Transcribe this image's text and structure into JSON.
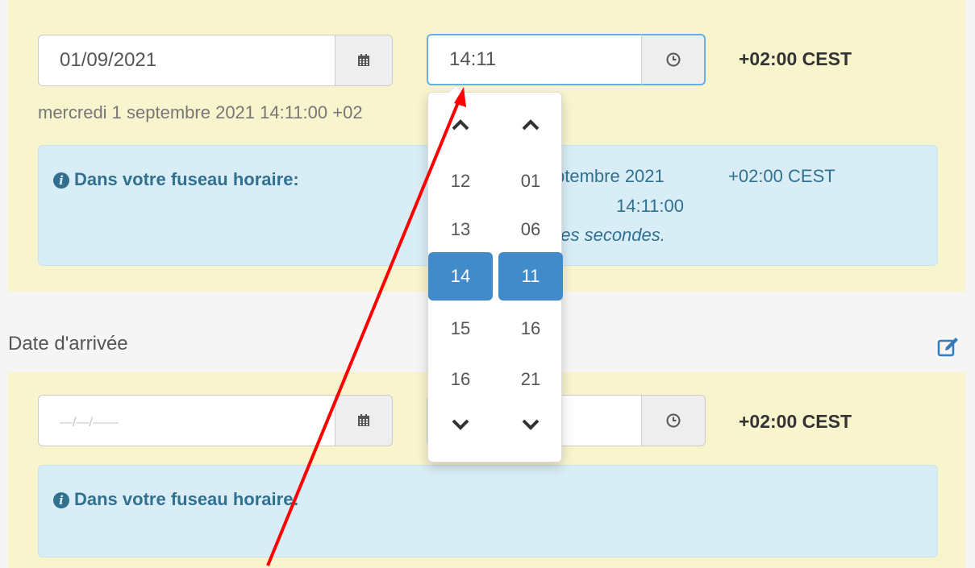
{
  "departure": {
    "date_value": "01/09/2021",
    "time_value": "14:11",
    "timezone": "+02:00 CEST",
    "full_date_text": "mercredi 1 septembre 2021 14:11:00 +02",
    "info": {
      "title": "Dans votre fuseau horaire:",
      "date_partial": "ptembre 2021",
      "time": "14:11:00",
      "timezone": "+02:00 CEST",
      "relative_partial": "ues secondes."
    }
  },
  "time_picker": {
    "hours": [
      "12",
      "13",
      "14",
      "15",
      "16"
    ],
    "minutes": [
      "01",
      "06",
      "11",
      "16",
      "21"
    ],
    "selected_hour": "14",
    "selected_minute": "11"
  },
  "arrival": {
    "label": "Date d'arrivée",
    "date_placeholder": "—/—/——",
    "timezone": "+02:00 CEST",
    "info": {
      "title": "Dans votre fuseau horaire:"
    }
  },
  "colors": {
    "panel_bg": "#f8f4cd",
    "info_bg": "#d9edf7",
    "info_text": "#31708f",
    "selected_bg": "#428bca",
    "annotation": "#ff0000"
  }
}
